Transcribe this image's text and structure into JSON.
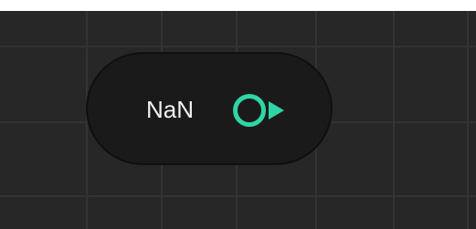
{
  "node": {
    "value_label": "NaN",
    "port_icon": "output-port-arrow-icon"
  },
  "colors": {
    "canvas_bg": "#272727",
    "grid_line": "#333333",
    "node_bg": "#1a1a1a",
    "label_text": "#f2f2f2",
    "port_accent": "#2fd5a4"
  }
}
